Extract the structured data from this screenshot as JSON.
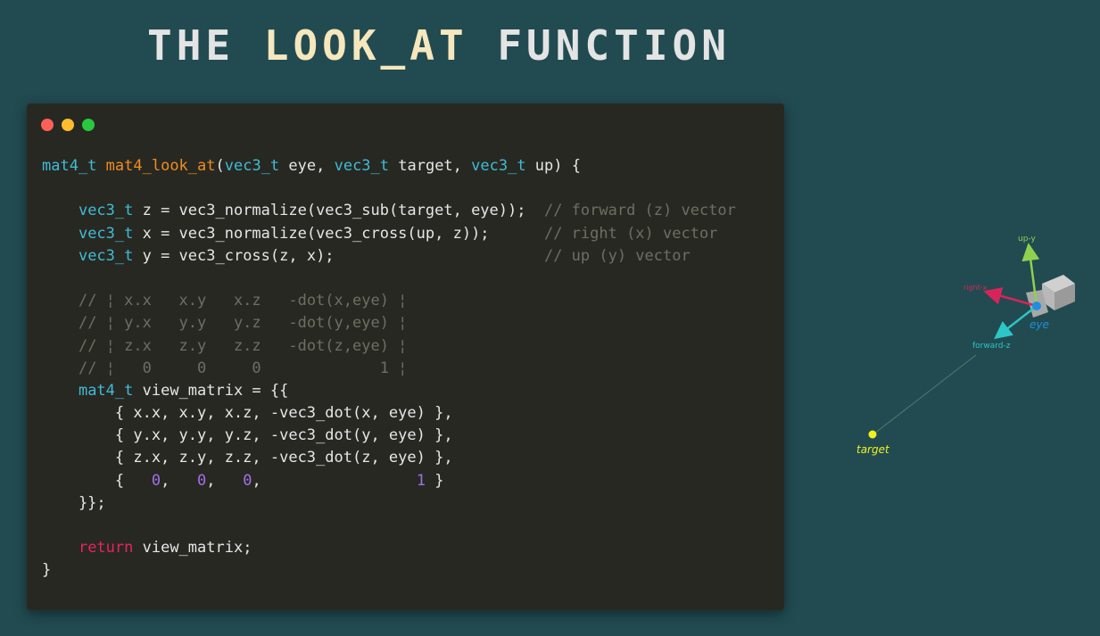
{
  "title": {
    "part1": "THE ",
    "part2": "LOOK_AT",
    "part3": " FUNCTION"
  },
  "window_controls": {
    "close": "#ff5f57",
    "minimize": "#febc2e",
    "maximize": "#28c840"
  },
  "colors": {
    "background": "#214b51",
    "card": "#272822",
    "type": "#3fbcd6",
    "function": "#f08c1e",
    "comment": "#6e6e62",
    "keyword": "#e8245e",
    "number": "#a070e8"
  },
  "code_lines": [
    [
      [
        "type",
        "mat4_t"
      ],
      [
        "plain",
        " "
      ],
      [
        "fn",
        "mat4_look_at"
      ],
      [
        "plain",
        "("
      ],
      [
        "type",
        "vec3_t"
      ],
      [
        "plain",
        " eye, "
      ],
      [
        "type",
        "vec3_t"
      ],
      [
        "plain",
        " target, "
      ],
      [
        "type",
        "vec3_t"
      ],
      [
        "plain",
        " up) {"
      ]
    ],
    [],
    [
      [
        "plain",
        "    "
      ],
      [
        "type",
        "vec3_t"
      ],
      [
        "plain",
        " z = vec3_normalize(vec3_sub(target, eye));  "
      ],
      [
        "cm",
        "// forward (z) vector"
      ]
    ],
    [
      [
        "plain",
        "    "
      ],
      [
        "type",
        "vec3_t"
      ],
      [
        "plain",
        " x = vec3_normalize(vec3_cross(up, z));      "
      ],
      [
        "cm",
        "// right (x) vector"
      ]
    ],
    [
      [
        "plain",
        "    "
      ],
      [
        "type",
        "vec3_t"
      ],
      [
        "plain",
        " y = vec3_cross(z, x);                       "
      ],
      [
        "cm",
        "// up (y) vector"
      ]
    ],
    [],
    [
      [
        "plain",
        "    "
      ],
      [
        "cm",
        "// ¦ x.x   x.y   x.z   -dot(x,eye) ¦"
      ]
    ],
    [
      [
        "plain",
        "    "
      ],
      [
        "cm",
        "// ¦ y.x   y.y   y.z   -dot(y,eye) ¦"
      ]
    ],
    [
      [
        "plain",
        "    "
      ],
      [
        "cm",
        "// ¦ z.x   z.y   z.z   -dot(z,eye) ¦"
      ]
    ],
    [
      [
        "plain",
        "    "
      ],
      [
        "cm",
        "// ¦   0     0     0             1 ¦"
      ]
    ],
    [
      [
        "plain",
        "    "
      ],
      [
        "type",
        "mat4_t"
      ],
      [
        "plain",
        " view_matrix = {{"
      ]
    ],
    [
      [
        "plain",
        "        { x.x, x.y, x.z, -vec3_dot(x, eye) },"
      ]
    ],
    [
      [
        "plain",
        "        { y.x, y.y, y.z, -vec3_dot(y, eye) },"
      ]
    ],
    [
      [
        "plain",
        "        { z.x, z.y, z.z, -vec3_dot(z, eye) },"
      ]
    ],
    [
      [
        "plain",
        "        {   "
      ],
      [
        "num",
        "0"
      ],
      [
        "plain",
        ",   "
      ],
      [
        "num",
        "0"
      ],
      [
        "plain",
        ",   "
      ],
      [
        "num",
        "0"
      ],
      [
        "plain",
        ",                 "
      ],
      [
        "num",
        "1"
      ],
      [
        "plain",
        " }"
      ]
    ],
    [
      [
        "plain",
        "    }};"
      ]
    ],
    [],
    [
      [
        "plain",
        "    "
      ],
      [
        "kw",
        "return"
      ],
      [
        "plain",
        " view_matrix;"
      ]
    ],
    [
      [
        "plain",
        "}"
      ]
    ]
  ],
  "diagram": {
    "labels": {
      "up": "up-y",
      "right": "right-x",
      "forward": "forward-z",
      "eye": "eye",
      "target": "target"
    },
    "colors": {
      "up": "#8fd14f",
      "right": "#d8245a",
      "forward": "#2cc6c6",
      "eye": "#1f8fe0",
      "target": "#f0f020"
    }
  }
}
